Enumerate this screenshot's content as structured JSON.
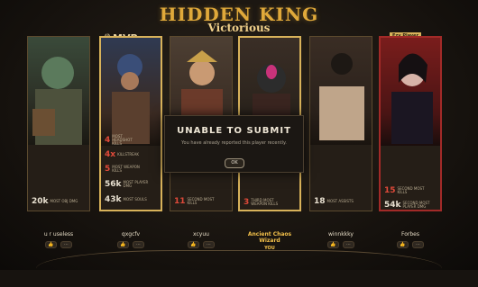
{
  "header": {
    "title": "HIDDEN KING",
    "subtitle": "Victorious"
  },
  "modal": {
    "title": "Unable to submit",
    "message": "You have already reported this player recently.",
    "ok": "OK"
  },
  "labels": {
    "mvp": "MVP",
    "ezp": "Ezy Player",
    "you": "YOU"
  },
  "players": [
    {
      "name": "u r useless",
      "hero": "",
      "stats": [
        {
          "v": "20k",
          "l": "MOST OBJ DMG"
        }
      ]
    },
    {
      "name": "qxgcfv",
      "hero": "",
      "stats": [
        {
          "v": "4",
          "l": "MOST HEADSHOT KILLS"
        },
        {
          "v": "4x",
          "l": "KILLSTREAK"
        },
        {
          "v": "5",
          "l": "MOST WEAPON KILLS"
        },
        {
          "v": "56k",
          "l": "MOST PLAYER DMG"
        },
        {
          "v": "43k",
          "l": "MOST SOULS"
        }
      ]
    },
    {
      "name": "xcyuu",
      "hero": "",
      "stats": [
        {
          "v": "11",
          "l": "SECOND MOST KILLS"
        }
      ]
    },
    {
      "name": "Ancient Chaos Wizard",
      "hero": "",
      "stats": [
        {
          "v": "3",
          "l": "THIRD MOST WEAPON KILLS"
        }
      ]
    },
    {
      "name": "winnkkky",
      "hero": "",
      "stats": [
        {
          "v": "18",
          "l": "MOST ASSISTS"
        }
      ]
    },
    {
      "name": "Forbes",
      "hero": "",
      "stats": [
        {
          "v": "15",
          "l": "SECOND MOST KILLS"
        },
        {
          "v": "54k",
          "l": "SECOND MOST PLAYER DMG"
        }
      ]
    }
  ]
}
